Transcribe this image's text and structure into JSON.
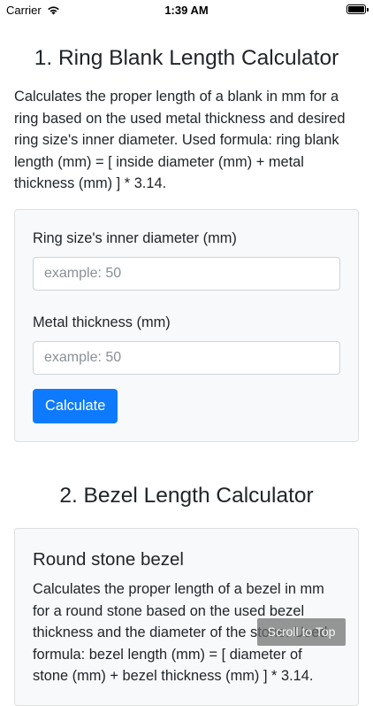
{
  "status_bar": {
    "carrier": "Carrier",
    "time": "1:39 AM"
  },
  "section1": {
    "title": "1. Ring Blank Length Calculator",
    "description": "Calculates the proper length of a blank in mm for a ring based on the used metal thickness and desired ring size's inner diameter. Used formula: ring blank length (mm) = [ inside diameter (mm) + metal thickness (mm) ] * 3.14.",
    "inner_diameter_label": "Ring size's inner diameter (mm)",
    "inner_diameter_placeholder": "example: 50",
    "inner_diameter_value": "",
    "metal_thickness_label": "Metal thickness (mm)",
    "metal_thickness_placeholder": "example: 50",
    "metal_thickness_value": "",
    "calculate_label": "Calculate"
  },
  "section2": {
    "title": "2. Bezel Length Calculator",
    "card_title": "Round stone bezel",
    "card_description": "Calculates the proper length of a bezel in mm for a round stone based on the used bezel thickness and the diameter of the stone. Used formula: bezel length (mm) = [ diameter of stone (mm) + bezel thickness (mm) ] * 3.14."
  },
  "scroll_to_top_label": "Scroll to Top"
}
